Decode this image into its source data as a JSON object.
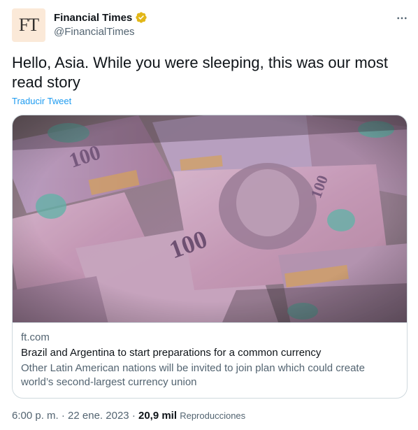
{
  "tweet": {
    "author": {
      "avatar_text": "FT",
      "name": "Financial Times",
      "handle": "@FinancialTimes",
      "verified_color": "#e2b719"
    },
    "text": "Hello, Asia. While you were sleeping, this was our most read story",
    "translate_label": "Traducir Tweet",
    "card": {
      "domain": "ft.com",
      "title": "Brazil and Argentina to start preparations for a common currency",
      "description": "Other Latin American nations will be invited to join plan which could create world’s second-largest currency union"
    },
    "meta": {
      "time": "6:00 p. m.",
      "separator": "·",
      "date": "22 ene. 2023",
      "views_count": "20,9 mil",
      "views_label": "Reproducciones"
    }
  },
  "colors": {
    "link": "#1d9bf0",
    "secondary_text": "#536471",
    "border": "#cfd9de"
  }
}
